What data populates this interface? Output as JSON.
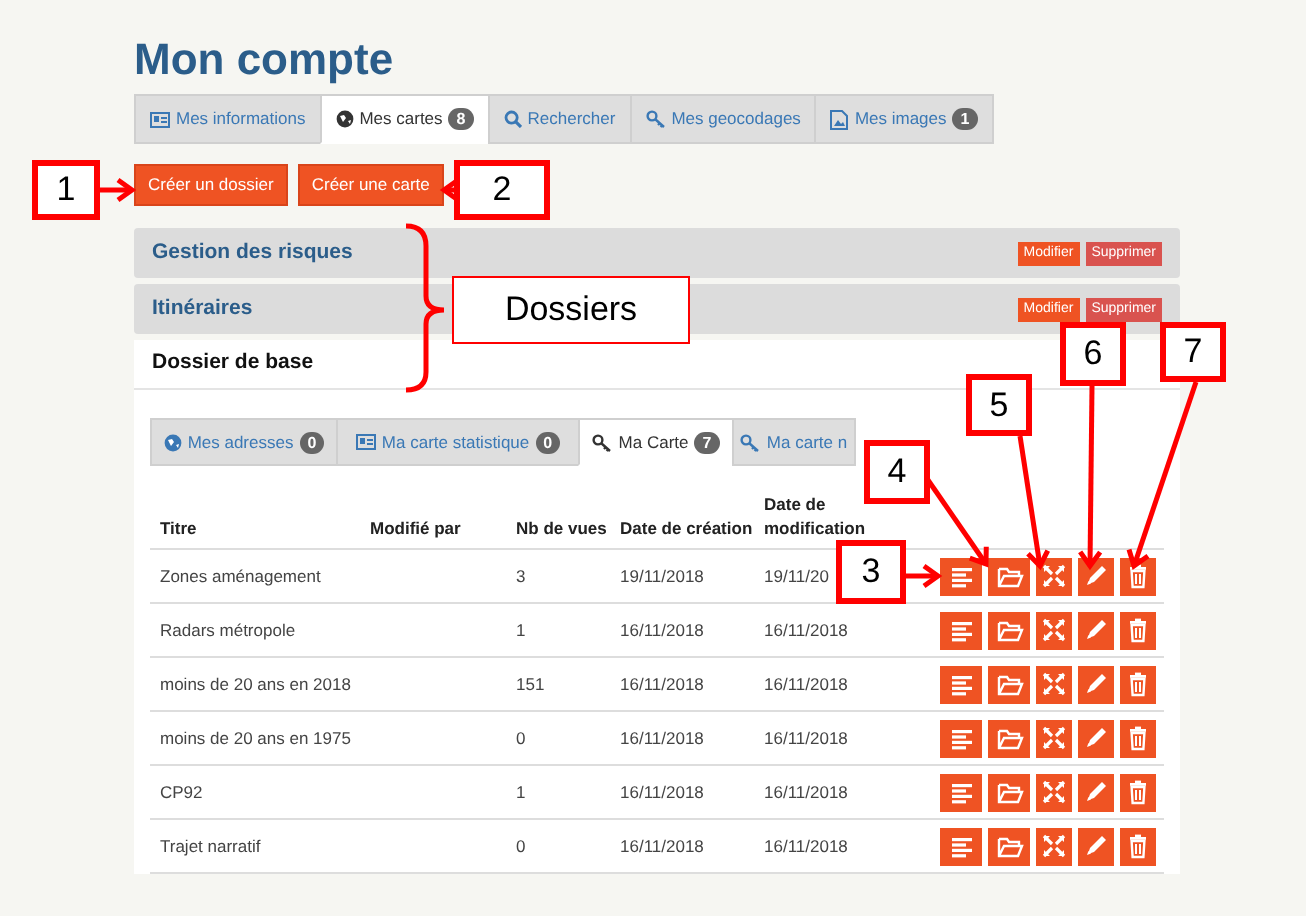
{
  "title": "Mon compte",
  "tabs": [
    {
      "label": "Mes informations",
      "selected": false
    },
    {
      "label": "Mes cartes",
      "badge": "8",
      "selected": true
    },
    {
      "label": "Rechercher",
      "selected": false
    },
    {
      "label": "Mes geocodages",
      "selected": false
    },
    {
      "label": "Mes images",
      "badge": "1",
      "selected": false
    }
  ],
  "buttons": [
    "Créer un dossier",
    "Créer une carte"
  ],
  "folders": [
    {
      "name": "Gestion des risques",
      "expanded": false,
      "actions": [
        "Modifier",
        "Supprimer"
      ]
    },
    {
      "name": "Itinéraires",
      "expanded": false,
      "actions": [
        "Modifier",
        "Supprimer"
      ]
    },
    {
      "name": "Dossier de base",
      "expanded": true
    }
  ],
  "subtabs": [
    {
      "label": "Mes adresses",
      "badge": "0",
      "selected": false
    },
    {
      "label": "Ma carte statistique",
      "badge": "0",
      "selected": false
    },
    {
      "label": "Ma Carte",
      "badge": "7",
      "selected": true
    },
    {
      "label": "Ma carte n",
      "selected": false
    }
  ],
  "table": {
    "columns": [
      "Titre",
      "Modifié par",
      "Nb de vues",
      "Date de création",
      "Date de modification"
    ],
    "rows": [
      {
        "title": "Zones aménagement",
        "views": "3",
        "created": "19/11/2018",
        "modified": "19/11/20"
      },
      {
        "title": "Radars métropole",
        "views": "1",
        "created": "16/11/2018",
        "modified": "16/11/2018"
      },
      {
        "title": "moins de 20 ans en 2018",
        "views": "151",
        "created": "16/11/2018",
        "modified": "16/11/2018"
      },
      {
        "title": "moins de 20 ans en 1975",
        "views": "0",
        "created": "16/11/2018",
        "modified": "16/11/2018"
      },
      {
        "title": "CP92",
        "views": "1",
        "created": "16/11/2018",
        "modified": "16/11/2018"
      },
      {
        "title": "Trajet narratif",
        "views": "0",
        "created": "16/11/2018",
        "modified": "16/11/2018"
      }
    ]
  },
  "annotations": {
    "callouts": [
      "1",
      "2",
      "3",
      "4",
      "5",
      "6",
      "7"
    ],
    "bracket_label": "Dossiers"
  }
}
